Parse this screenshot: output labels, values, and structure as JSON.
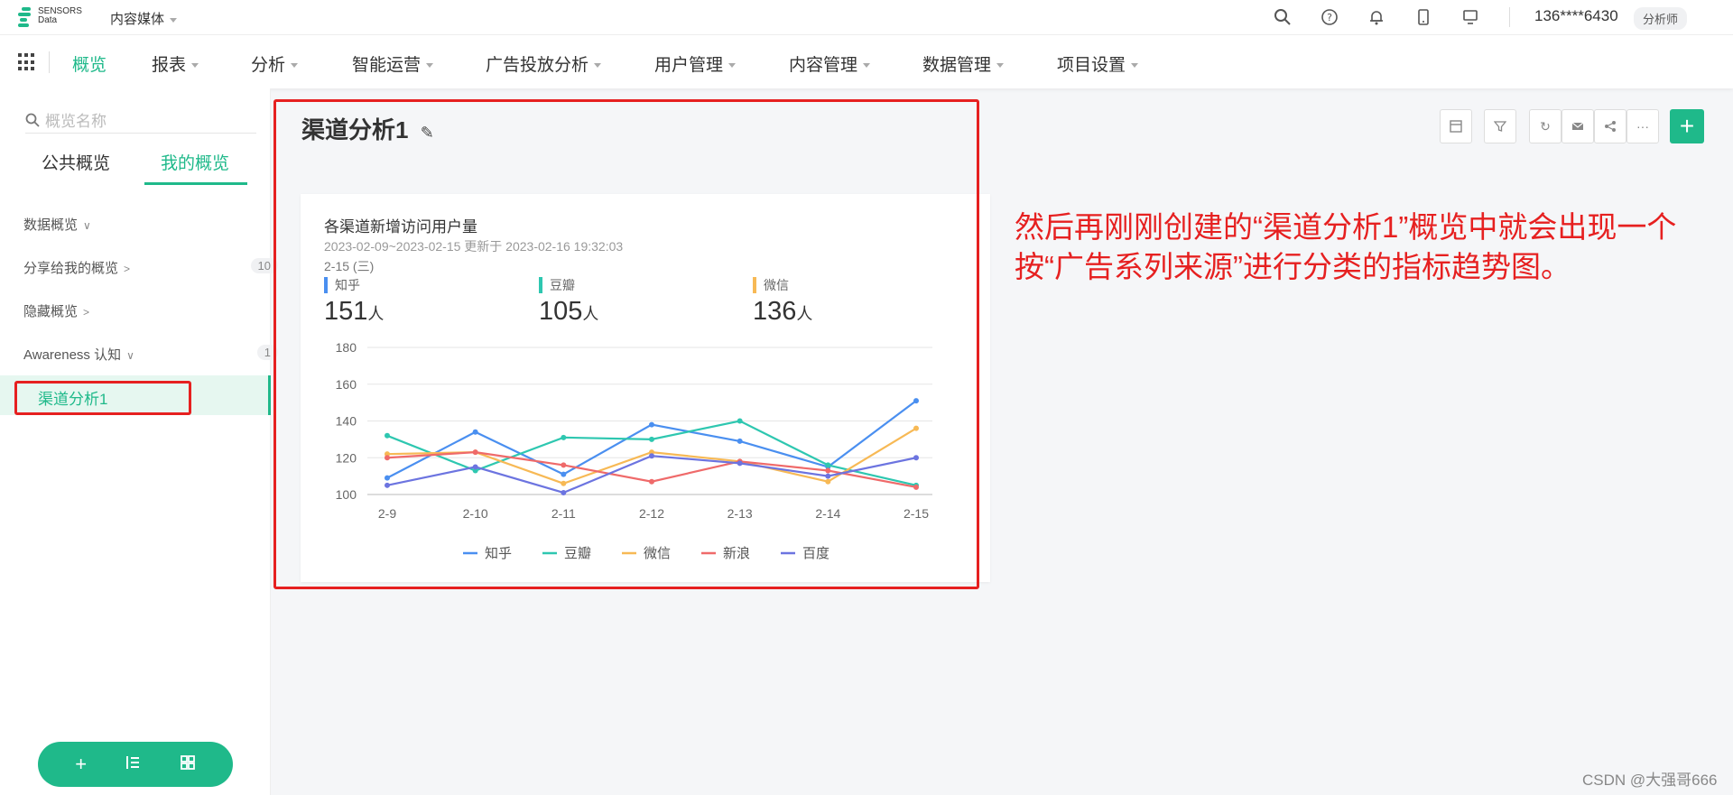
{
  "topbar": {
    "logo_line1": "SENSORS",
    "logo_line2": "Data",
    "project": "内容媒体",
    "user": "136****6430",
    "role": "分析师"
  },
  "nav": {
    "items": [
      "概览",
      "报表",
      "分析",
      "智能运营",
      "广告投放分析",
      "用户管理",
      "内容管理",
      "数据管理",
      "项目设置"
    ]
  },
  "sidebar": {
    "search_placeholder": "概览名称",
    "tabs": [
      "公共概览",
      "我的概览"
    ],
    "groups": [
      {
        "label": "数据概览",
        "count": ""
      },
      {
        "label": "分享给我的概览",
        "count": "10"
      },
      {
        "label": "隐藏概览",
        "count": ""
      },
      {
        "label": "Awareness 认知",
        "count": "1"
      }
    ],
    "selected": "渠道分析1"
  },
  "main": {
    "title": "渠道分析1"
  },
  "card": {
    "title": "各渠道新增访问用户量",
    "subtitle": "2023-02-09~2023-02-15 更新于 2023-02-16 19:32:03",
    "date": "2-15 (三)",
    "metrics": [
      {
        "label": "知乎",
        "value": "151",
        "unit": "人",
        "color": "#4a8ff0"
      },
      {
        "label": "豆瓣",
        "value": "105",
        "unit": "人",
        "color": "#2ec7b0"
      },
      {
        "label": "微信",
        "value": "136",
        "unit": "人",
        "color": "#f7b955"
      }
    ]
  },
  "chart_data": {
    "type": "line",
    "categories": [
      "2-9",
      "2-10",
      "2-11",
      "2-12",
      "2-13",
      "2-14",
      "2-15"
    ],
    "ylim": [
      100,
      180
    ],
    "yticks": [
      100,
      120,
      140,
      160,
      180
    ],
    "grid": true,
    "legend_position": "bottom",
    "series": [
      {
        "name": "知乎",
        "color": "#4a8ff0",
        "values": [
          109,
          134,
          111,
          138,
          129,
          115,
          151
        ]
      },
      {
        "name": "豆瓣",
        "color": "#2ec7b0",
        "values": [
          132,
          113,
          131,
          130,
          140,
          116,
          105
        ]
      },
      {
        "name": "微信",
        "color": "#f7b955",
        "values": [
          122,
          123,
          106,
          123,
          118,
          107,
          136
        ]
      },
      {
        "name": "新浪",
        "color": "#ef6a6a",
        "values": [
          120,
          123,
          116,
          107,
          118,
          113,
          104
        ]
      },
      {
        "name": "百度",
        "color": "#6c74e0",
        "values": [
          105,
          115,
          101,
          121,
          117,
          110,
          120
        ]
      }
    ]
  },
  "annotation": "然后再刚刚创建的“渠道分析1”概览中就会出现一个按“广告系列来源”进行分类的指标趋势图。",
  "watermark": "CSDN @大强哥666"
}
